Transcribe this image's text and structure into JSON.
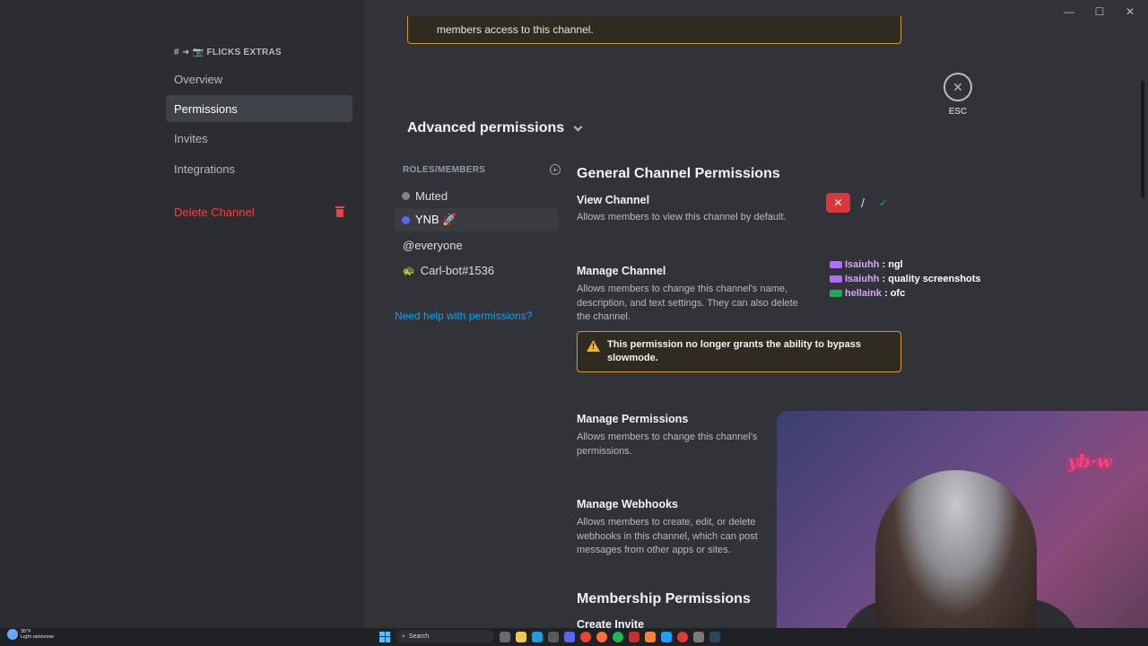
{
  "window": {
    "minimize": "—",
    "maximize": "☐",
    "close": "✕"
  },
  "sidebar": {
    "channel_header": "# ➜ 📷 FLICKS EXTRAS",
    "items": [
      {
        "label": "Overview"
      },
      {
        "label": "Permissions"
      },
      {
        "label": "Invites"
      },
      {
        "label": "Integrations"
      }
    ],
    "delete_label": "Delete Channel"
  },
  "main": {
    "top_notice": "members access to this channel.",
    "advanced_title": "Advanced permissions",
    "roles_header": "ROLES/MEMBERS",
    "roles": [
      {
        "label": "Muted",
        "color": "#80848e"
      },
      {
        "label": "YNB 🚀",
        "color": "#5865f2"
      },
      {
        "label": "@everyone"
      },
      {
        "label": "Carl-bot#1536",
        "emoji": "🐢"
      }
    ],
    "help_link": "Need help with permissions?",
    "section_general": "General Channel Permissions",
    "view_channel": {
      "title": "View Channel",
      "desc": "Allows members to view this channel by default.",
      "deny": "✕",
      "neutral": "/",
      "allow": "✓"
    },
    "manage_channel": {
      "title": "Manage Channel",
      "desc": "Allows members to change this channel's name, description, and text settings. They can also delete the channel."
    },
    "warning": {
      "icon": "!",
      "text": "This permission no longer grants the ability to bypass slowmode."
    },
    "manage_permissions": {
      "title": "Manage Permissions",
      "desc": "Allows members to change this channel's permissions."
    },
    "manage_webhooks": {
      "title": "Manage Webhooks",
      "desc": "Allows members to create, edit, or delete webhooks in this channel, which can post messages from other apps or sites."
    },
    "section_membership": "Membership Permissions",
    "create_invite": "Create Invite",
    "esc": {
      "icon": "✕",
      "label": "ESC"
    }
  },
  "chat_overlay": [
    {
      "user": "Isaiuhh",
      "message": ": ngl"
    },
    {
      "user": "Isaiuhh",
      "message": ": quality screenshots"
    },
    {
      "user": "hellaink",
      "message": ": ofc"
    }
  ],
  "webcam": {
    "neon_sign": "yb·w"
  },
  "taskbar": {
    "weather_temp": "35°F",
    "weather_desc": "Light rain/snow",
    "search_label": "Search"
  }
}
